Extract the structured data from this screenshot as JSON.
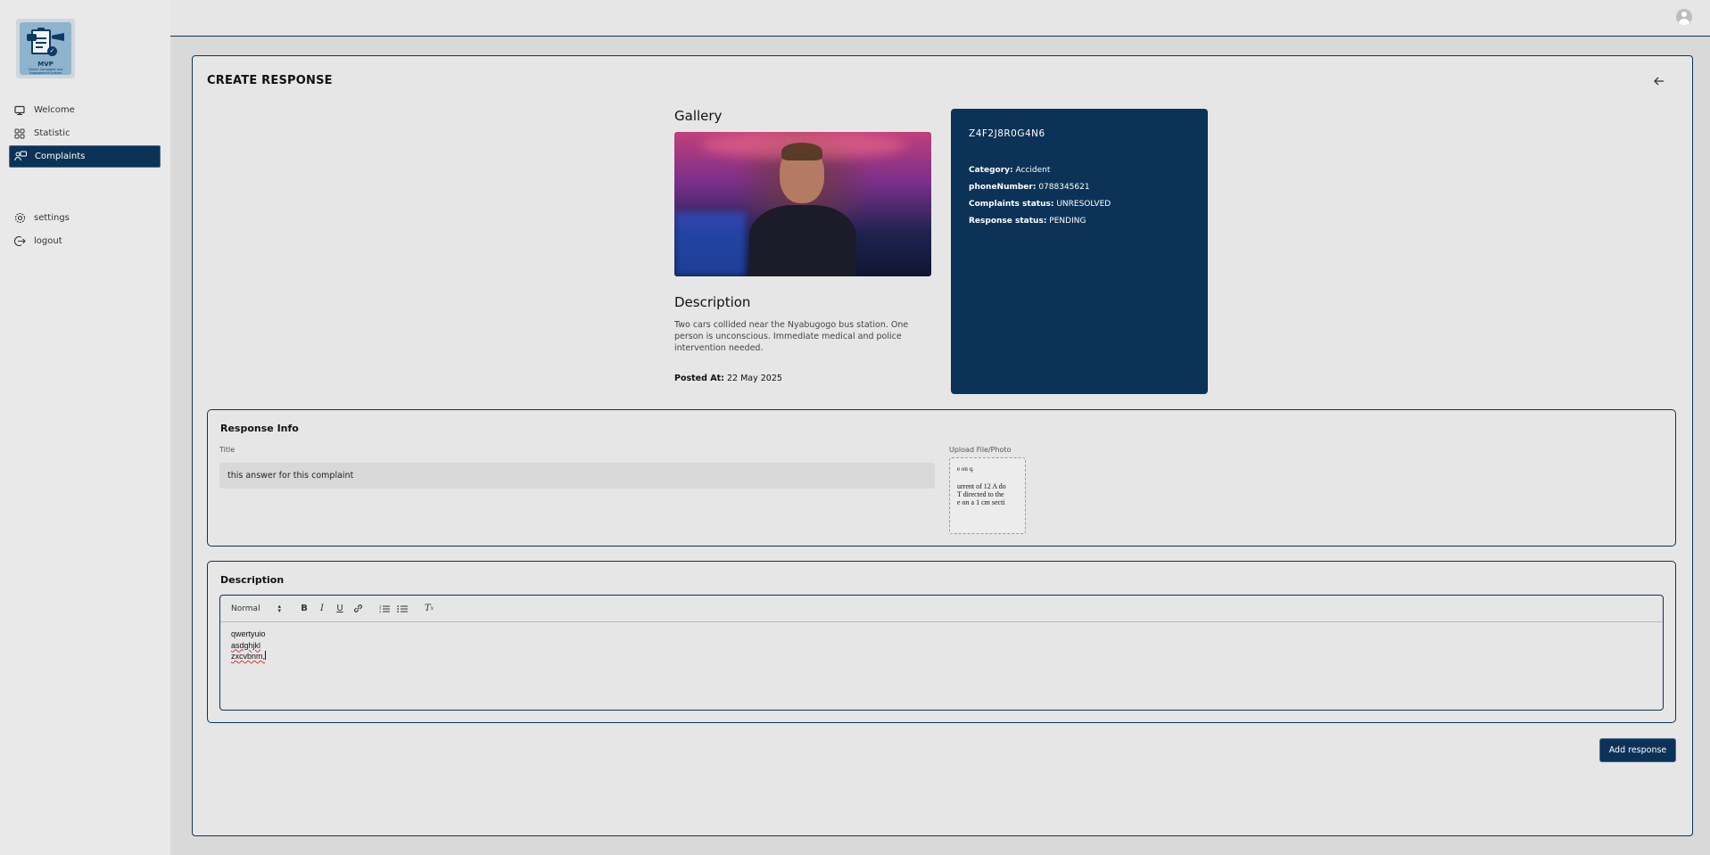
{
  "sidebar": {
    "logo_title": "MVP",
    "logo_subtitle": "Citizen Complaint and Engagement System",
    "items": [
      {
        "label": "Welcome",
        "icon": "monitor-icon"
      },
      {
        "label": "Statistic",
        "icon": "grid-icon"
      },
      {
        "label": "Complaints",
        "icon": "chat-user-icon",
        "active": true
      },
      {
        "label": "settings",
        "icon": "gear-icon"
      },
      {
        "label": "logout",
        "icon": "logout-icon"
      }
    ]
  },
  "header": {
    "avatar_icon": "user-avatar-icon"
  },
  "page": {
    "title": "CREATE RESPONSE",
    "back_icon": "arrow-left-icon"
  },
  "complaint": {
    "gallery_heading": "Gallery",
    "description_heading": "Description",
    "description": "Two cars collided near the Nyabugogo bus station. One person is unconscious. Immediate medical and police intervention needed.",
    "posted_label": "Posted At:",
    "posted_value": "22 May 2025"
  },
  "info_card": {
    "code": "Z4F2J8R0G4N6",
    "category_label": "Category:",
    "category_value": "Accident",
    "phone_label": "phoneNumber:",
    "phone_value": "0788345621",
    "complaint_status_label": "Complaints status:",
    "complaint_status_value": "UNRESOLVED",
    "response_status_label": "Response status:",
    "response_status_value": "PENDING",
    "bg_color": "#0c3357"
  },
  "response_info": {
    "heading": "Response Info",
    "title_label": "Title",
    "title_value": "this answer for this complaint",
    "upload_label": "Upload File/Photo",
    "upload_preview_lines": [
      "e on q.",
      "urrent of 12 A do",
      "T directed to the",
      "e on a 1 cm secti"
    ]
  },
  "description_editor": {
    "heading": "Description",
    "format_select": "Normal",
    "toolbar": [
      "B",
      "I",
      "U",
      "link",
      "ordered-list",
      "bullet-list",
      "clear-format"
    ],
    "lines": [
      "qwertyuio",
      "asdghjkl",
      "zxcvbnm,"
    ]
  },
  "actions": {
    "submit_label": "Add response"
  },
  "colors": {
    "primary": "#0c3357",
    "background": "#e6e6e6"
  }
}
